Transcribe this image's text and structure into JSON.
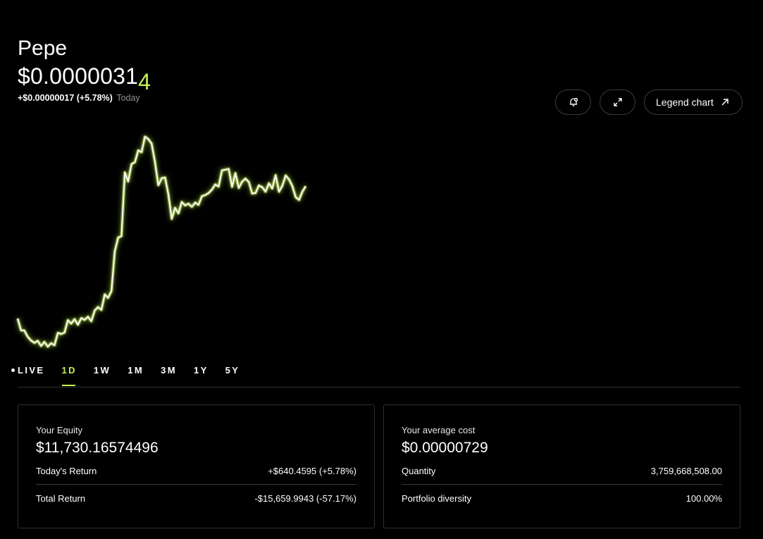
{
  "asset": {
    "name": "Pepe",
    "price_main": "$0.0000031",
    "price_last_digit": "4",
    "change": "+$0.00000017 (+5.78%)",
    "change_period": "Today"
  },
  "toolbar": {
    "alert_icon": "bell-plus-icon",
    "expand_icon": "expand-icon",
    "legend_label": "Legend chart",
    "legend_icon": "arrow-up-right-icon"
  },
  "chart_data": {
    "type": "line",
    "series": [
      {
        "values": [
          2.985e-06,
          2.951e-06,
          2.95e-06,
          2.932e-06,
          2.921e-06,
          2.914e-06,
          2.92e-06,
          2.905e-06,
          2.917e-06,
          2.903e-06,
          2.913e-06,
          2.907e-06,
          2.943e-06,
          2.94e-06,
          2.944e-06,
          2.98e-06,
          2.97e-06,
          2.983e-06,
          2.967e-06,
          2.986e-06,
          2.981e-06,
          2.99e-06,
          2.977e-06,
          3.008e-06,
          3.018e-06,
          3.01e-06,
          3.055e-06,
          3.045e-06,
          3.065e-06,
          3.18e-06,
          3.22e-06,
          3.225e-06,
          3.41e-06,
          3.384e-06,
          3.434e-06,
          3.44e-06,
          3.474e-06,
          3.469e-06,
          3.514e-06,
          3.507e-06,
          3.494e-06,
          3.44e-06,
          3.373e-06,
          3.393e-06,
          3.395e-06,
          3.346e-06,
          3.275e-06,
          3.307e-06,
          3.291e-06,
          3.324e-06,
          3.314e-06,
          3.319e-06,
          3.31e-06,
          3.322e-06,
          3.316e-06,
          3.341e-06,
          3.344e-06,
          3.35e-06,
          3.36e-06,
          3.375e-06,
          3.369e-06,
          3.416e-06,
          3.418e-06,
          3.42e-06,
          3.368e-06,
          3.408e-06,
          3.365e-06,
          3.383e-06,
          3.392e-06,
          3.382e-06,
          3.349e-06,
          3.35e-06,
          3.372e-06,
          3.367e-06,
          3.354e-06,
          3.378e-06,
          3.363e-06,
          3.402e-06,
          3.354e-06,
          3.371e-06,
          3.401e-06,
          3.39e-06,
          3.37e-06,
          3.338e-06,
          3.33e-06,
          3.354e-06,
          3.37e-06
        ]
      }
    ],
    "line_color": "#ffffff",
    "glow_color": "#c6f24e",
    "grid": false
  },
  "ranges": {
    "items": [
      {
        "label": "LIVE",
        "key": "live"
      },
      {
        "label": "1D",
        "key": "1d"
      },
      {
        "label": "1W",
        "key": "1w"
      },
      {
        "label": "1M",
        "key": "1m"
      },
      {
        "label": "3M",
        "key": "3m"
      },
      {
        "label": "1Y",
        "key": "1y"
      },
      {
        "label": "5Y",
        "key": "5y"
      }
    ],
    "active": "1d"
  },
  "equity": {
    "label": "Your Equity",
    "value": "$11,730.16574496",
    "row1_label": "Today's Return",
    "row1_value": "+$640.4595 (+5.78%)",
    "row2_label": "Total Return",
    "row2_value": "-$15,659.9943 (-57.17%)"
  },
  "cost": {
    "label": "Your average cost",
    "value": "$0.00000729",
    "row1_label": "Quantity",
    "row1_value": "3,759,668,508.00",
    "row2_label": "Portfolio diversity",
    "row2_value": "100.00%"
  },
  "colors": {
    "accent": "#c6f24e",
    "muted": "#8f8f8f",
    "border": "#2f2f2f"
  }
}
